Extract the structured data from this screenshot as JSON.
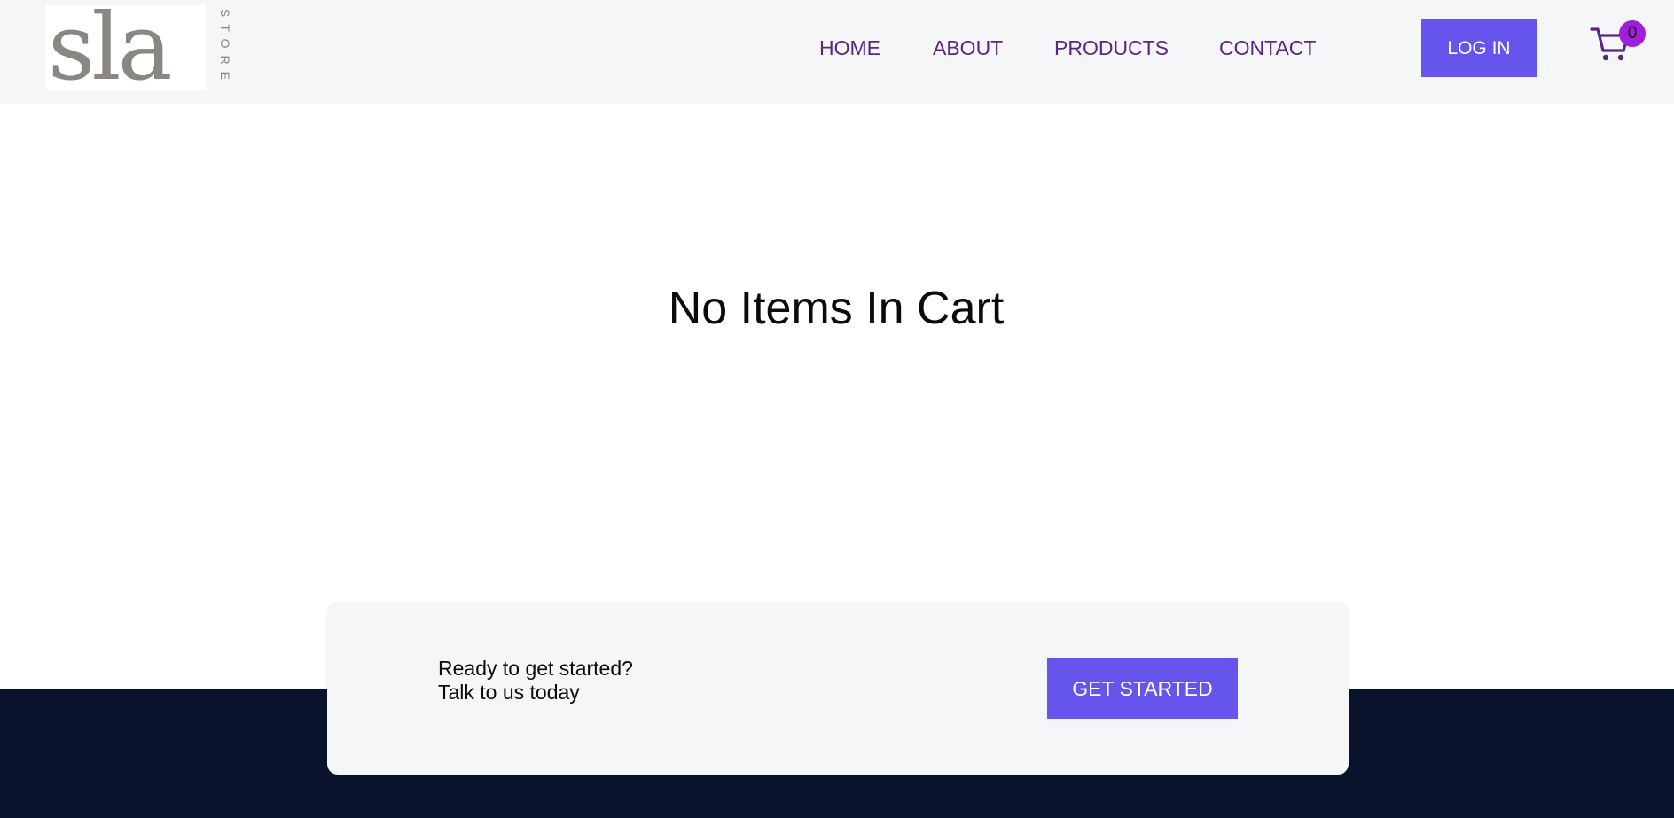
{
  "brand": {
    "logo_text": "sla",
    "logo_sub": "STORE",
    "logo_color": "#8a8681"
  },
  "nav": {
    "items": [
      {
        "label": "HOME"
      },
      {
        "label": "ABOUT"
      },
      {
        "label": "PRODUCTS"
      },
      {
        "label": "CONTACT"
      }
    ],
    "link_color": "#5b2486"
  },
  "header": {
    "login_label": "LOG IN",
    "cart_icon": "cart-icon",
    "cart_count": "0",
    "badge_color": "#a01fd8"
  },
  "main": {
    "empty_message": "No Items In Cart"
  },
  "cta": {
    "line1": "Ready to get started?",
    "line2": "Talk to us today",
    "button_label": "GET STARTED"
  },
  "colors": {
    "accent": "#6555ec",
    "header_bg": "#f5f6f8",
    "footer_bg": "#09132c"
  }
}
